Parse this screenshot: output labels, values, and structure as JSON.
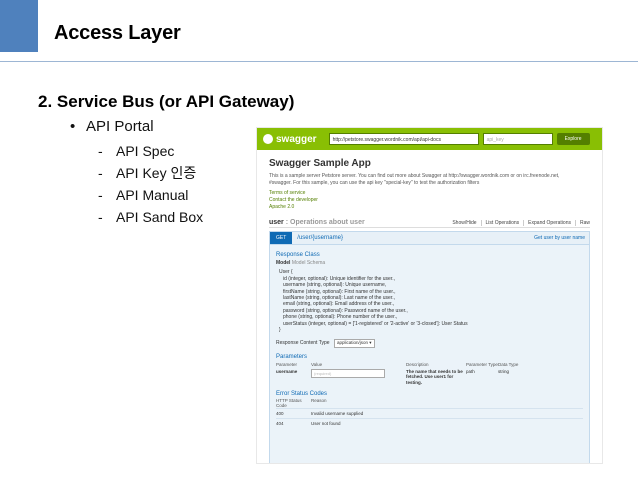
{
  "slide": {
    "title": "Access Layer",
    "heading": "2. Service Bus (or API Gateway)",
    "bullet": "API Portal",
    "bullet_marker": "•",
    "dash": "-",
    "subitems": [
      "API Spec",
      "API Key 인증",
      "API Manual",
      "API Sand Box"
    ],
    "accent_color": "#4f81bd"
  },
  "swagger": {
    "brand": "swagger",
    "url": "http://petstore.swagger.wordnik.com/api/api-docs",
    "api_key_placeholder": "api_key",
    "explore_label": "Explore",
    "app_title": "Swagger Sample App",
    "description": "This is a sample server Petstore server. You can find out more about Swagger at http://swagger.wordnik.com or on irc.freenode.net, #swagger. For this sample, you can use the api key \"special-key\" to test the authorization filters",
    "links": [
      "Terms of service",
      "Contact the developer",
      "Apache 2.0"
    ],
    "resource_name": "user",
    "resource_desc": " : Operations about user",
    "resource_links": [
      "Show/Hide",
      "List Operations",
      "Expand Operations",
      "Raw"
    ],
    "op_method": "GET",
    "op_path": "/user/{username}",
    "op_summary": "Get user by user name",
    "response_class": "Response Class",
    "model_label": "Model",
    "model_schema": "Model Schema",
    "model_lines": [
      "User {",
      "id (integer, optional): Unique identifier for the user.,",
      "username (string, optional): Unique username,",
      "firstName (string, optional): First name of the user.,",
      "lastName (string, optional): Last name of the user.,",
      "email (string, optional): Email address of the user.,",
      "password (string, optional): Password name of the user.,",
      "phone (string, optional): Phone number of the user.,",
      "userStatus (integer, optional) = ['1-registered' or '2-active' or '3-closed']: User Status",
      "}"
    ],
    "content_type_label": "Response Content Type",
    "content_type_value": "application/json",
    "parameters_title": "Parameters",
    "param_headers": [
      "Parameter",
      "Value",
      "Description",
      "Parameter Type",
      "Data Type"
    ],
    "param_name": "username",
    "param_placeholder": "(required)",
    "param_desc": "The name that needs to be fetched. Use user1 for testing.",
    "param_type": "path",
    "param_datatype": "string",
    "errors_title": "Error Status Codes",
    "error_headers": [
      "HTTP Status Code",
      "Reason"
    ],
    "errors": [
      {
        "code": "400",
        "reason": "Invalid username supplied"
      },
      {
        "code": "404",
        "reason": "User not found"
      }
    ],
    "brand_color": "#89bf04"
  }
}
